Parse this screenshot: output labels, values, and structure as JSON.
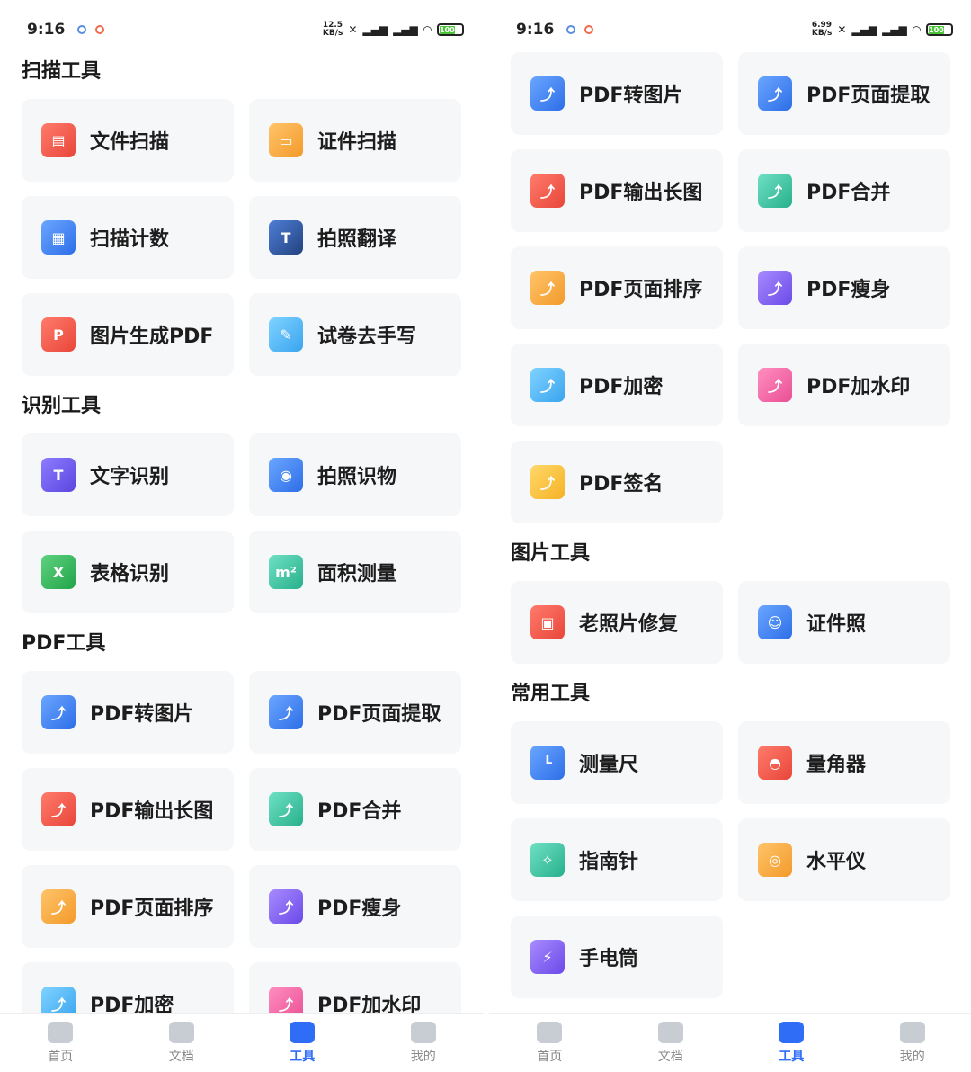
{
  "status": {
    "time": "9:16",
    "speed_left": [
      "12.5",
      "KB/s"
    ],
    "speed_right": [
      "6.99",
      "KB/s"
    ],
    "battery": "100"
  },
  "left": {
    "sections": [
      {
        "title": "扫描工具",
        "items": [
          {
            "label": "文件扫描",
            "icon": "document-scan-icon",
            "color": "red"
          },
          {
            "label": "证件扫描",
            "icon": "id-card-scan-icon",
            "color": "orange"
          },
          {
            "label": "扫描计数",
            "icon": "scan-count-icon",
            "color": "blue"
          },
          {
            "label": "拍照翻译",
            "icon": "photo-translate-icon",
            "color": "navy"
          },
          {
            "label": "图片生成PDF",
            "icon": "image-to-pdf-icon",
            "color": "red"
          },
          {
            "label": "试卷去手写",
            "icon": "exam-remove-handwriting-icon",
            "color": "sky"
          }
        ]
      },
      {
        "title": "识别工具",
        "items": [
          {
            "label": "文字识别",
            "icon": "text-recognition-icon",
            "color": "purple"
          },
          {
            "label": "拍照识物",
            "icon": "camera-identify-icon",
            "color": "blue"
          },
          {
            "label": "表格识别",
            "icon": "excel-recognition-icon",
            "color": "green"
          },
          {
            "label": "面积测量",
            "icon": "area-measure-icon",
            "color": "teal"
          }
        ]
      },
      {
        "title": "PDF工具",
        "items": [
          {
            "label": "PDF转图片",
            "icon": "pdf-to-image-icon",
            "color": "blue"
          },
          {
            "label": "PDF页面提取",
            "icon": "pdf-page-extract-icon",
            "color": "blue"
          },
          {
            "label": "PDF输出长图",
            "icon": "pdf-long-image-icon",
            "color": "red"
          },
          {
            "label": "PDF合并",
            "icon": "pdf-merge-icon",
            "color": "teal"
          },
          {
            "label": "PDF页面排序",
            "icon": "pdf-page-sort-icon",
            "color": "orange"
          },
          {
            "label": "PDF瘦身",
            "icon": "pdf-compress-icon",
            "color": "violet"
          },
          {
            "label": "PDF加密",
            "icon": "pdf-encrypt-icon",
            "color": "sky"
          },
          {
            "label": "PDF加水印",
            "icon": "pdf-watermark-icon",
            "color": "pink"
          }
        ]
      }
    ]
  },
  "right": {
    "sections": [
      {
        "title": "",
        "items": [
          {
            "label": "PDF转图片",
            "icon": "pdf-to-image-icon",
            "color": "blue"
          },
          {
            "label": "PDF页面提取",
            "icon": "pdf-page-extract-icon",
            "color": "blue"
          },
          {
            "label": "PDF输出长图",
            "icon": "pdf-long-image-icon",
            "color": "red"
          },
          {
            "label": "PDF合并",
            "icon": "pdf-merge-icon",
            "color": "teal"
          },
          {
            "label": "PDF页面排序",
            "icon": "pdf-page-sort-icon",
            "color": "orange"
          },
          {
            "label": "PDF瘦身",
            "icon": "pdf-compress-icon",
            "color": "violet"
          },
          {
            "label": "PDF加密",
            "icon": "pdf-encrypt-icon",
            "color": "sky"
          },
          {
            "label": "PDF加水印",
            "icon": "pdf-watermark-icon",
            "color": "pink"
          },
          {
            "label": "PDF签名",
            "icon": "pdf-sign-icon",
            "color": "yellow"
          }
        ]
      },
      {
        "title": "图片工具",
        "items": [
          {
            "label": "老照片修复",
            "icon": "old-photo-repair-icon",
            "color": "red"
          },
          {
            "label": "证件照",
            "icon": "id-photo-icon",
            "color": "blue"
          }
        ]
      },
      {
        "title": "常用工具",
        "items": [
          {
            "label": "测量尺",
            "icon": "ruler-icon",
            "color": "blue"
          },
          {
            "label": "量角器",
            "icon": "protractor-icon",
            "color": "red"
          },
          {
            "label": "指南针",
            "icon": "compass-icon",
            "color": "teal"
          },
          {
            "label": "水平仪",
            "icon": "level-icon",
            "color": "orange"
          },
          {
            "label": "手电筒",
            "icon": "flashlight-icon",
            "color": "violet"
          }
        ]
      }
    ]
  },
  "tabs": [
    {
      "label": "首页",
      "icon": "home-icon",
      "active": false
    },
    {
      "label": "文档",
      "icon": "document-icon",
      "active": false
    },
    {
      "label": "工具",
      "icon": "toolbox-icon",
      "active": true
    },
    {
      "label": "我的",
      "icon": "profile-icon",
      "active": false
    }
  ],
  "colors": {
    "accent": "#2f6df6",
    "card_bg": "#f6f7f9"
  }
}
